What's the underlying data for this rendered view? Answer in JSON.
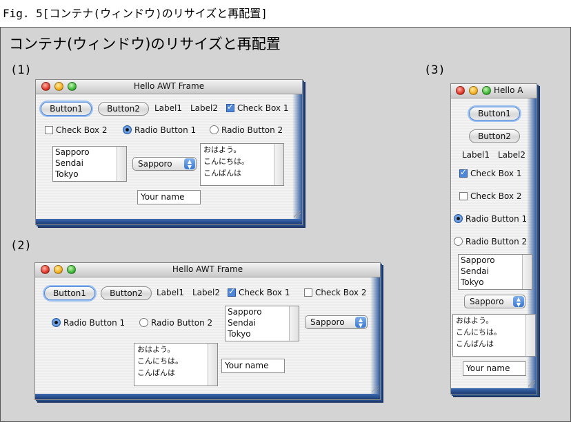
{
  "figure_caption": "Fig. 5[コンテナ(ウィンドウ)のリサイズと再配置]",
  "panel_title": "コンテナ(ウィンドウ)のリサイズと再配置",
  "steps": [
    "(1)",
    "(2)",
    "(3)"
  ],
  "window1": {
    "title": "Hello AWT Frame",
    "button1": "Button1",
    "button2": "Button2",
    "label1": "Label1",
    "label2": "Label2",
    "checkbox1": "Check Box 1",
    "checkbox2": "Check Box 2",
    "radio1": "Radio Button 1",
    "radio2": "Radio Button 2",
    "list_items": [
      "Sapporo",
      "Sendai",
      "Tokyo"
    ],
    "choice_value": "Sapporo",
    "textarea_lines": [
      "おはよう。",
      "こんにちは。",
      "こんばんは"
    ],
    "textfield_value": "Your name"
  },
  "window2": {
    "title": "Hello AWT Frame",
    "button1": "Button1",
    "button2": "Button2",
    "label1": "Label1",
    "label2": "Label2",
    "checkbox1": "Check Box 1",
    "checkbox2": "Check Box 2",
    "radio1": "Radio Button 1",
    "radio2": "Radio Button 2",
    "list_items": [
      "Sapporo",
      "Sendai",
      "Tokyo"
    ],
    "choice_value": "Sapporo",
    "textarea_lines": [
      "おはよう。",
      "こんにちは。",
      "こんばんは"
    ],
    "textfield_value": "Your name"
  },
  "window3": {
    "title": "Hello A",
    "button1": "Button1",
    "button2": "Button2",
    "label1": "Label1",
    "label2": "Label2",
    "checkbox1": "Check Box 1",
    "checkbox2": "Check Box 2",
    "radio1": "Radio Button 1",
    "radio2": "Radio Button 2",
    "list_items": [
      "Sapporo",
      "Sendai",
      "Tokyo"
    ],
    "choice_value": "Sapporo",
    "textarea_lines": [
      "おはよう。",
      "こんにちは。",
      "こんばんは"
    ],
    "textfield_value": "Your name"
  },
  "checkbox1_checked": true,
  "checkbox2_checked": false,
  "selected_radio": "radio1",
  "icons": [
    "close-button-icon",
    "minimize-button-icon",
    "zoom-button-icon",
    "resize-grip-icon",
    "choice-arrows-icon"
  ]
}
